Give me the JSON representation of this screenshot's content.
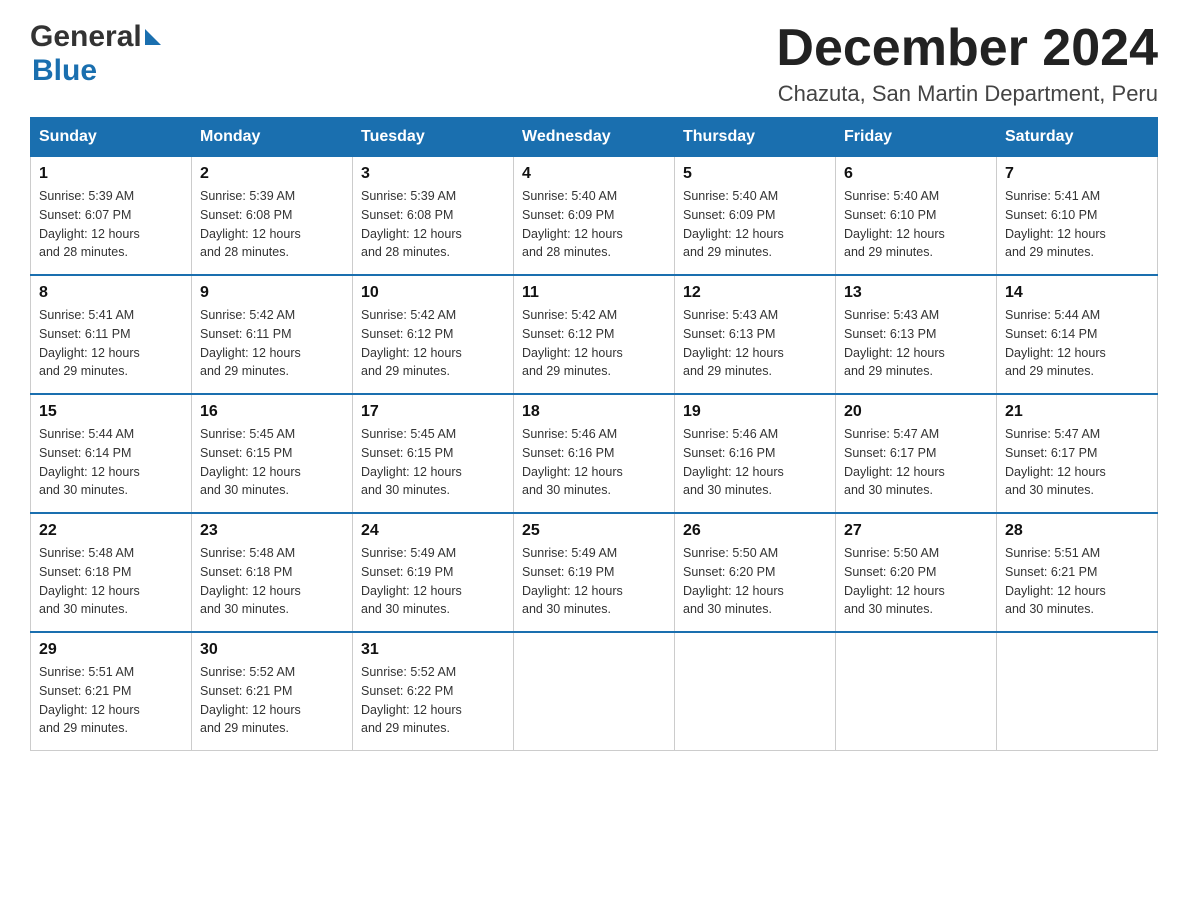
{
  "header": {
    "logo_general": "General",
    "logo_blue": "Blue",
    "month_title": "December 2024",
    "location": "Chazuta, San Martin Department, Peru"
  },
  "weekdays": [
    "Sunday",
    "Monday",
    "Tuesday",
    "Wednesday",
    "Thursday",
    "Friday",
    "Saturday"
  ],
  "weeks": [
    [
      {
        "day": "1",
        "sunrise": "5:39 AM",
        "sunset": "6:07 PM",
        "daylight": "12 hours and 28 minutes."
      },
      {
        "day": "2",
        "sunrise": "5:39 AM",
        "sunset": "6:08 PM",
        "daylight": "12 hours and 28 minutes."
      },
      {
        "day": "3",
        "sunrise": "5:39 AM",
        "sunset": "6:08 PM",
        "daylight": "12 hours and 28 minutes."
      },
      {
        "day": "4",
        "sunrise": "5:40 AM",
        "sunset": "6:09 PM",
        "daylight": "12 hours and 28 minutes."
      },
      {
        "day": "5",
        "sunrise": "5:40 AM",
        "sunset": "6:09 PM",
        "daylight": "12 hours and 29 minutes."
      },
      {
        "day": "6",
        "sunrise": "5:40 AM",
        "sunset": "6:10 PM",
        "daylight": "12 hours and 29 minutes."
      },
      {
        "day": "7",
        "sunrise": "5:41 AM",
        "sunset": "6:10 PM",
        "daylight": "12 hours and 29 minutes."
      }
    ],
    [
      {
        "day": "8",
        "sunrise": "5:41 AM",
        "sunset": "6:11 PM",
        "daylight": "12 hours and 29 minutes."
      },
      {
        "day": "9",
        "sunrise": "5:42 AM",
        "sunset": "6:11 PM",
        "daylight": "12 hours and 29 minutes."
      },
      {
        "day": "10",
        "sunrise": "5:42 AM",
        "sunset": "6:12 PM",
        "daylight": "12 hours and 29 minutes."
      },
      {
        "day": "11",
        "sunrise": "5:42 AM",
        "sunset": "6:12 PM",
        "daylight": "12 hours and 29 minutes."
      },
      {
        "day": "12",
        "sunrise": "5:43 AM",
        "sunset": "6:13 PM",
        "daylight": "12 hours and 29 minutes."
      },
      {
        "day": "13",
        "sunrise": "5:43 AM",
        "sunset": "6:13 PM",
        "daylight": "12 hours and 29 minutes."
      },
      {
        "day": "14",
        "sunrise": "5:44 AM",
        "sunset": "6:14 PM",
        "daylight": "12 hours and 29 minutes."
      }
    ],
    [
      {
        "day": "15",
        "sunrise": "5:44 AM",
        "sunset": "6:14 PM",
        "daylight": "12 hours and 30 minutes."
      },
      {
        "day": "16",
        "sunrise": "5:45 AM",
        "sunset": "6:15 PM",
        "daylight": "12 hours and 30 minutes."
      },
      {
        "day": "17",
        "sunrise": "5:45 AM",
        "sunset": "6:15 PM",
        "daylight": "12 hours and 30 minutes."
      },
      {
        "day": "18",
        "sunrise": "5:46 AM",
        "sunset": "6:16 PM",
        "daylight": "12 hours and 30 minutes."
      },
      {
        "day": "19",
        "sunrise": "5:46 AM",
        "sunset": "6:16 PM",
        "daylight": "12 hours and 30 minutes."
      },
      {
        "day": "20",
        "sunrise": "5:47 AM",
        "sunset": "6:17 PM",
        "daylight": "12 hours and 30 minutes."
      },
      {
        "day": "21",
        "sunrise": "5:47 AM",
        "sunset": "6:17 PM",
        "daylight": "12 hours and 30 minutes."
      }
    ],
    [
      {
        "day": "22",
        "sunrise": "5:48 AM",
        "sunset": "6:18 PM",
        "daylight": "12 hours and 30 minutes."
      },
      {
        "day": "23",
        "sunrise": "5:48 AM",
        "sunset": "6:18 PM",
        "daylight": "12 hours and 30 minutes."
      },
      {
        "day": "24",
        "sunrise": "5:49 AM",
        "sunset": "6:19 PM",
        "daylight": "12 hours and 30 minutes."
      },
      {
        "day": "25",
        "sunrise": "5:49 AM",
        "sunset": "6:19 PM",
        "daylight": "12 hours and 30 minutes."
      },
      {
        "day": "26",
        "sunrise": "5:50 AM",
        "sunset": "6:20 PM",
        "daylight": "12 hours and 30 minutes."
      },
      {
        "day": "27",
        "sunrise": "5:50 AM",
        "sunset": "6:20 PM",
        "daylight": "12 hours and 30 minutes."
      },
      {
        "day": "28",
        "sunrise": "5:51 AM",
        "sunset": "6:21 PM",
        "daylight": "12 hours and 30 minutes."
      }
    ],
    [
      {
        "day": "29",
        "sunrise": "5:51 AM",
        "sunset": "6:21 PM",
        "daylight": "12 hours and 29 minutes."
      },
      {
        "day": "30",
        "sunrise": "5:52 AM",
        "sunset": "6:21 PM",
        "daylight": "12 hours and 29 minutes."
      },
      {
        "day": "31",
        "sunrise": "5:52 AM",
        "sunset": "6:22 PM",
        "daylight": "12 hours and 29 minutes."
      },
      null,
      null,
      null,
      null
    ]
  ],
  "labels": {
    "sunrise": "Sunrise:",
    "sunset": "Sunset:",
    "daylight": "Daylight:"
  }
}
